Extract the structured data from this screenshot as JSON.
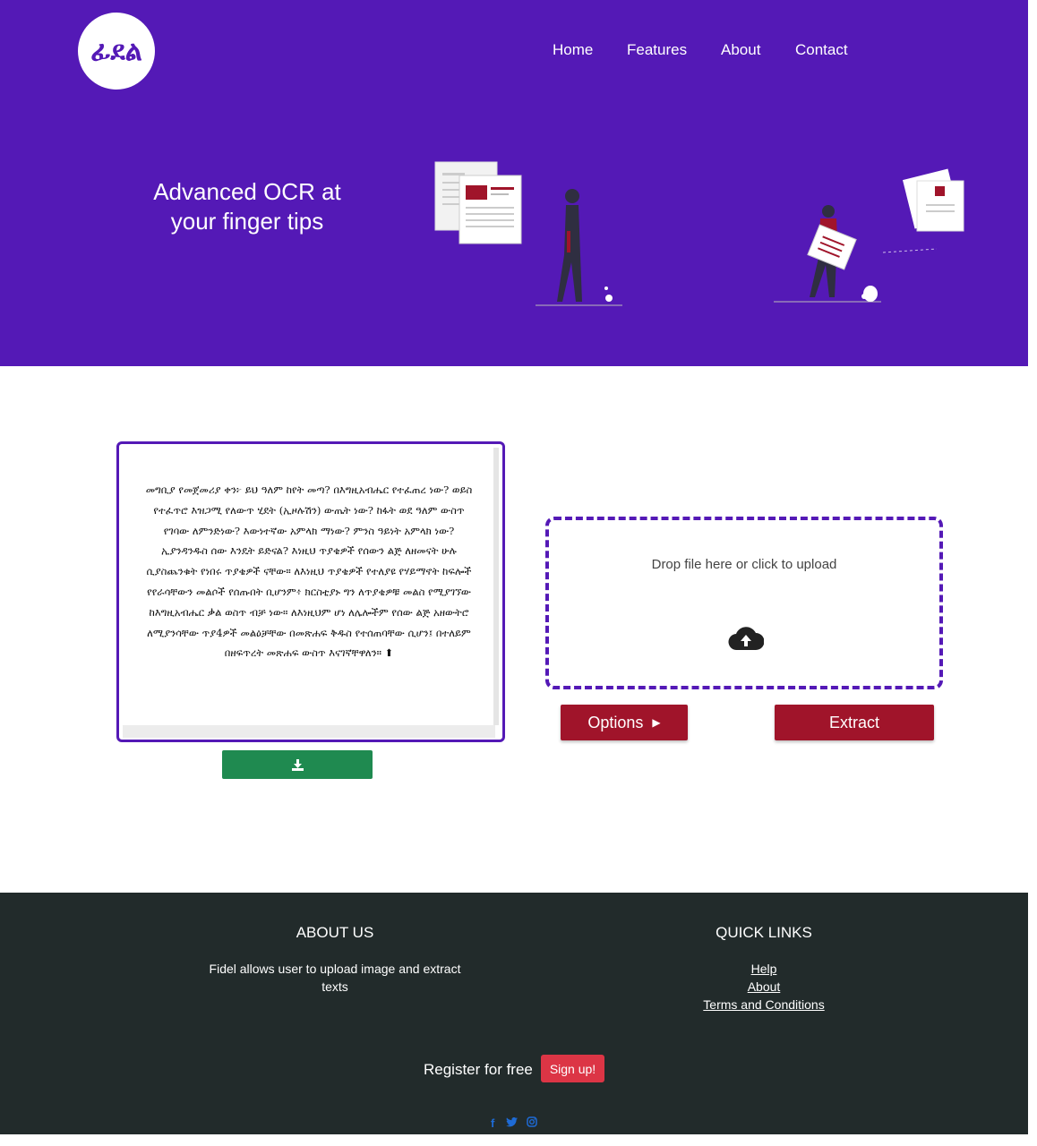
{
  "brand": {
    "logo_text": "ፊደል"
  },
  "nav": {
    "items": [
      "Home",
      "Features",
      "About",
      "Contact"
    ]
  },
  "hero": {
    "title": "Advanced OCR at your finger tips"
  },
  "editor": {
    "text": "መግቢያ የመጀመሪያ ቀን፦ ይህ ዓለም ከየት መጣ? በእግዚአብሔር የተፈጠረ ነው? ወይስ የተፈጥሮ እዝጋሚ የለውጥ ሂደት (ኢዞሉሽን) ውጤት ነው? ከፋት ወደ ዓለም ውስጥ የገባው ለምንድነው? እውነተኛው አምላክ ማነው? ምንስ ዓይነት አምላክ ነው? ኢያንዳንዱስ ሰው እንዴት ይድናል? እነዚህ ጥያቄዎች የሰውን ልጅ ለዘመናት ሁሉ ሲያስጨንቁት የነበሩ ጥያቄዎች ናቸው። ለእነዚህ ጥያቄዎች የተለያዩ የሃይማኖት ከፍሎች የየራሳቸውን መልሶች የሰጡበት ቢሆንም፥ ክርስቲያኑ ግን ለጥያቄዎቹ መልስ የሚያገኘው ከእግዚአብሔር ቃል ወስጥ ብቻ ነው። ለእነዚህም ሆነ ለሌሎችም የሰው ልጅ አዘውትሮ ለሚያንሳቸው ጥያ4ዎች መልዕቻቸው በመጽሐፍ ቅዱስ የተሰጠባቸው ሲሆን፤ በተለይም በዘፍጥረት መጽሐፍ ውስጥ እናገኛቸዋለን።"
  },
  "upload": {
    "drop_text": "Drop file here or click to upload"
  },
  "actions": {
    "options_label": "Options",
    "extract_label": "Extract"
  },
  "footer": {
    "about_heading": "ABOUT US",
    "about_text": "Fidel allows user to upload image and extract texts",
    "links_heading": "QUICK LINKS",
    "links": [
      "Help",
      "About",
      "Terms and Conditions"
    ],
    "register_text": "Register for free",
    "signup_label": "Sign up!"
  },
  "colors": {
    "hero": "#5419b6",
    "accent": "#a0142a",
    "download": "#1f8a50",
    "footer": "#222b2b",
    "signup": "#dc3545"
  }
}
